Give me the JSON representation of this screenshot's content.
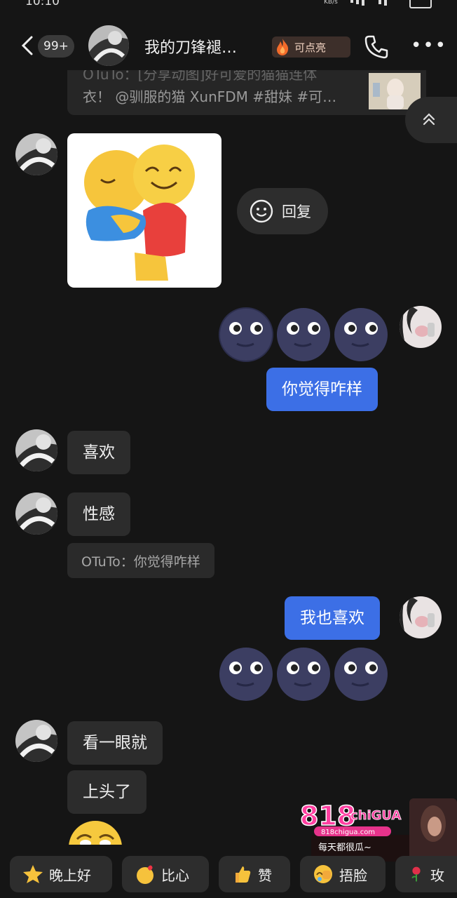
{
  "status_bar": {
    "time": "10:10",
    "net_speed": "KB/s"
  },
  "header": {
    "unread_count": "99+",
    "title": "我的刀锋褪…",
    "light_button": "可点亮",
    "icons": [
      "back-icon",
      "phone-icon",
      "more-icon"
    ]
  },
  "quoted_post": {
    "line1": "OTuTo：[分享动图]好可爱的猫猫连体",
    "line2": "衣！ @驯服的猫 XunFDM #甜妹 #可…"
  },
  "reply_button": {
    "label": "回复"
  },
  "messages": [
    {
      "side": "in",
      "type": "sticker",
      "sticker": "hug-emoji-sticker"
    },
    {
      "side": "out",
      "type": "emoji",
      "emoji": [
        "new-moon-face",
        "new-moon-face",
        "new-moon-face"
      ]
    },
    {
      "side": "out",
      "type": "text",
      "text": "你觉得咋样"
    },
    {
      "side": "in",
      "type": "text",
      "text": "喜欢"
    },
    {
      "side": "in",
      "type": "text",
      "text": "性感"
    },
    {
      "side": "in",
      "type": "quote",
      "text": "OTuTo：你觉得咋样"
    },
    {
      "side": "out",
      "type": "text",
      "text": "我也喜欢"
    },
    {
      "side": "out",
      "type": "emoji",
      "emoji": [
        "new-moon-face",
        "new-moon-face",
        "new-moon-face"
      ]
    },
    {
      "side": "in",
      "type": "text",
      "text": "看一眼就"
    },
    {
      "side": "in",
      "type": "text",
      "text": "上头了"
    }
  ],
  "quick_replies": [
    {
      "label": "晚上好",
      "icon": "star-icon"
    },
    {
      "label": "比心",
      "icon": "finger-heart-icon"
    },
    {
      "label": "赞",
      "icon": "thumbs-up-icon"
    },
    {
      "label": "捂脸",
      "icon": "facepalm-icon"
    },
    {
      "label": "玫",
      "icon": "rose-icon"
    }
  ],
  "watermark": {
    "logo_number": "818",
    "logo_text": "chiGUA",
    "url": "818chigua.com",
    "slogan": "每天都很瓜~"
  },
  "colors": {
    "background": "#151515",
    "incoming_bubble": "#2c2c2c",
    "outgoing_bubble": "#3c6fe6"
  }
}
